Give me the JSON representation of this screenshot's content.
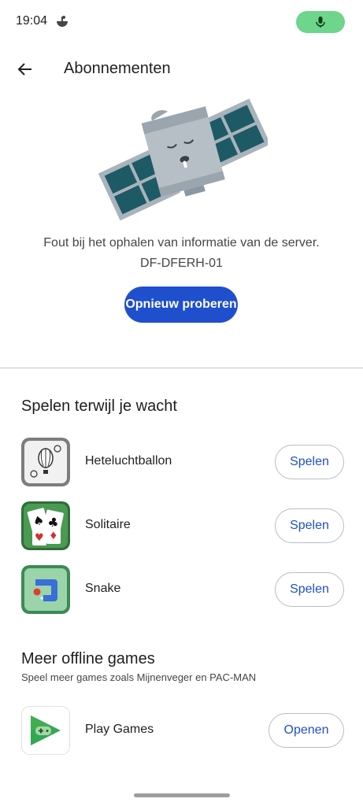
{
  "status_bar": {
    "time": "19:04"
  },
  "header": {
    "title": "Abonnementen"
  },
  "error": {
    "message": "Fout bij het ophalen van informatie van de server.",
    "code": "DF-DFERH-01",
    "retry_label": "Opnieuw proberen"
  },
  "games_section": {
    "title": "Spelen terwijl je wacht",
    "games": [
      {
        "name": "Heteluchtballon",
        "action": "Spelen"
      },
      {
        "name": "Solitaire",
        "action": "Spelen"
      },
      {
        "name": "Snake",
        "action": "Spelen"
      }
    ]
  },
  "offline_section": {
    "title": "Meer offline games",
    "subtitle": "Speel meer games zoals Mijnenveger en PAC-MAN",
    "app": {
      "name": "Play Games",
      "action": "Openen"
    }
  },
  "colors": {
    "accent": "#1f4fcc",
    "mic_pill": "#6dd58c",
    "divider": "#c4c7c5"
  }
}
